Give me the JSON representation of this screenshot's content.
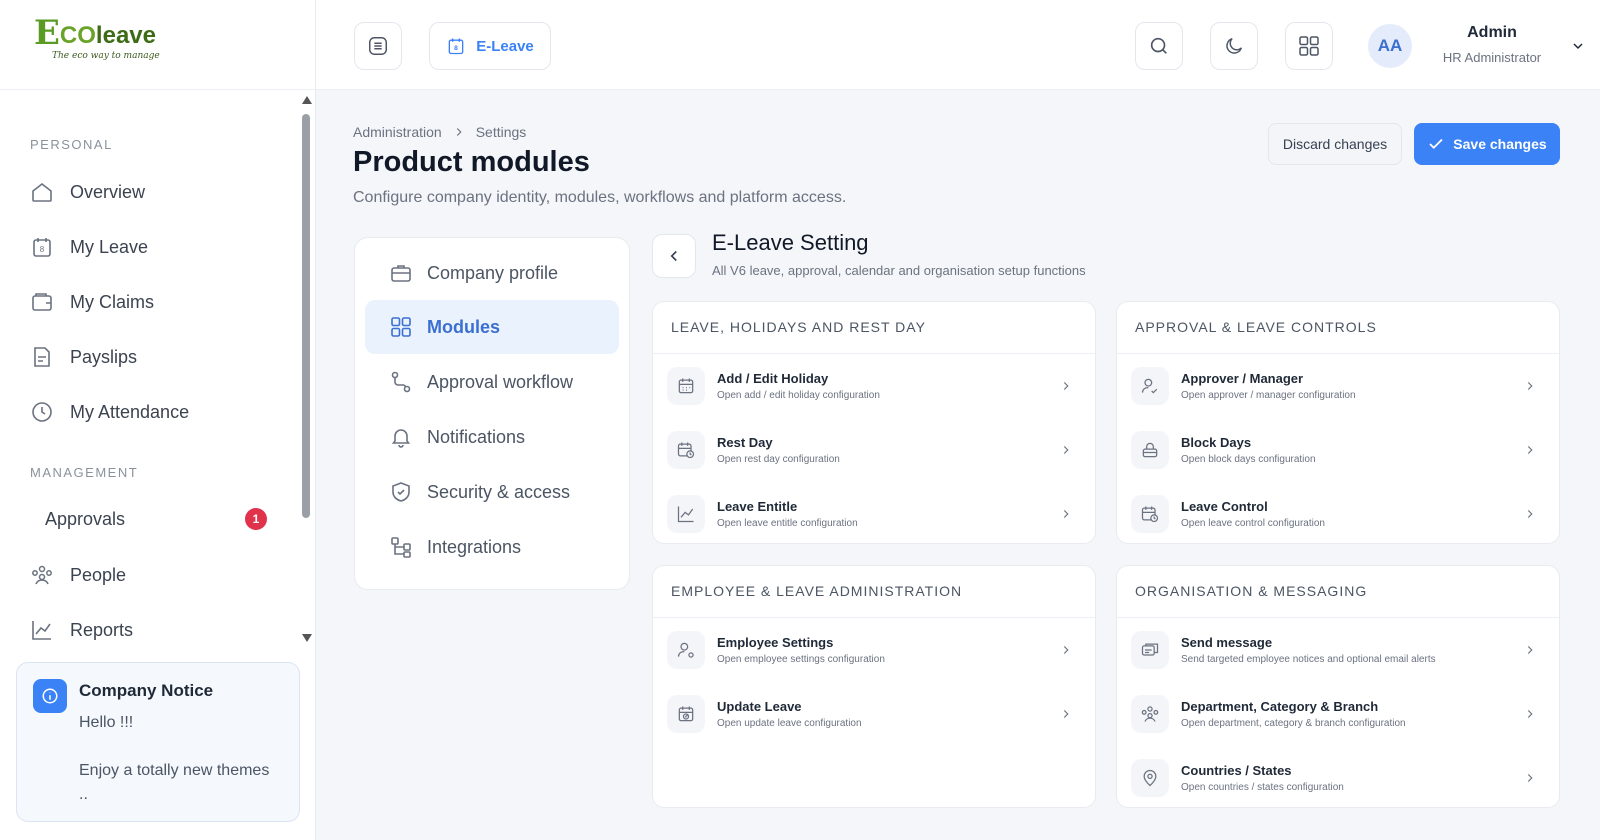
{
  "brand": {
    "logo_e": "E",
    "logo_co": "CO",
    "logo_leave": "leave",
    "tagline": "The eco way to manage"
  },
  "sidebar": {
    "personal_label": "PERSONAL",
    "management_label": "MANAGEMENT",
    "personal_items": [
      {
        "label": "Overview",
        "icon": "home-icon"
      },
      {
        "label": "My Leave",
        "icon": "calendar-8-icon"
      },
      {
        "label": "My Claims",
        "icon": "wallet-icon"
      },
      {
        "label": "Payslips",
        "icon": "document-icon"
      },
      {
        "label": "My Attendance",
        "icon": "clock-icon"
      }
    ],
    "management_items": [
      {
        "label": "Approvals",
        "badge": "1"
      },
      {
        "label": "People",
        "icon": "people-icon"
      },
      {
        "label": "Reports",
        "icon": "chart-line-icon"
      }
    ],
    "notice": {
      "title": "Company Notice",
      "body": "Hello !!!\n\nEnjoy a totally new themes\n.."
    }
  },
  "topbar": {
    "eleave_label": "E-Leave",
    "user_initials": "AA",
    "user_name": "Admin",
    "user_role": "HR Administrator"
  },
  "page": {
    "breadcrumb": [
      "Administration",
      "Settings"
    ],
    "title": "Product modules",
    "subtitle": "Configure company identity, modules, workflows and platform access.",
    "discard_label": "Discard changes",
    "save_label": "Save changes"
  },
  "settings_nav": [
    {
      "label": "Company profile",
      "icon": "briefcase-icon"
    },
    {
      "label": "Modules",
      "icon": "grid-icon",
      "active": true
    },
    {
      "label": "Approval workflow",
      "icon": "workflow-icon"
    },
    {
      "label": "Notifications",
      "icon": "bell-icon"
    },
    {
      "label": "Security & access",
      "icon": "shield-icon"
    },
    {
      "label": "Integrations",
      "icon": "integrations-icon"
    }
  ],
  "panel": {
    "title": "E-Leave Setting",
    "subtitle": "All V6 leave, approval, calendar and organisation setup functions",
    "sections": [
      {
        "heading": "LEAVE, HOLIDAYS AND REST DAY",
        "rows": [
          {
            "title": "Add / Edit Holiday",
            "desc": "Open add / edit holiday configuration",
            "icon": "calendar-icon"
          },
          {
            "title": "Rest Day",
            "desc": "Open rest day configuration",
            "icon": "calendar-clock-icon"
          },
          {
            "title": "Leave Entitle",
            "desc": "Open leave entitle configuration",
            "icon": "chart-line-icon"
          }
        ]
      },
      {
        "heading": "APPROVAL & LEAVE CONTROLS",
        "rows": [
          {
            "title": "Approver / Manager",
            "desc": "Open approver / manager configuration",
            "icon": "user-check-icon"
          },
          {
            "title": "Block Days",
            "desc": "Open block days configuration",
            "icon": "lock-icon"
          },
          {
            "title": "Leave Control",
            "desc": "Open leave control configuration",
            "icon": "calendar-clock-icon"
          }
        ]
      },
      {
        "heading": "EMPLOYEE & LEAVE ADMINISTRATION",
        "rows": [
          {
            "title": "Employee Settings",
            "desc": "Open employee settings configuration",
            "icon": "user-gear-icon"
          },
          {
            "title": "Update Leave",
            "desc": "Open update leave configuration",
            "icon": "calendar-edit-icon"
          }
        ]
      },
      {
        "heading": "ORGANISATION & MESSAGING",
        "rows": [
          {
            "title": "Send message",
            "desc": "Send targeted employee notices and optional email alerts",
            "icon": "message-icon"
          },
          {
            "title": "Department, Category & Branch",
            "desc": "Open department, category & branch configuration",
            "icon": "people-icon"
          },
          {
            "title": "Countries / States",
            "desc": "Open countries / states configuration",
            "icon": "map-pin-icon"
          }
        ]
      }
    ]
  }
}
